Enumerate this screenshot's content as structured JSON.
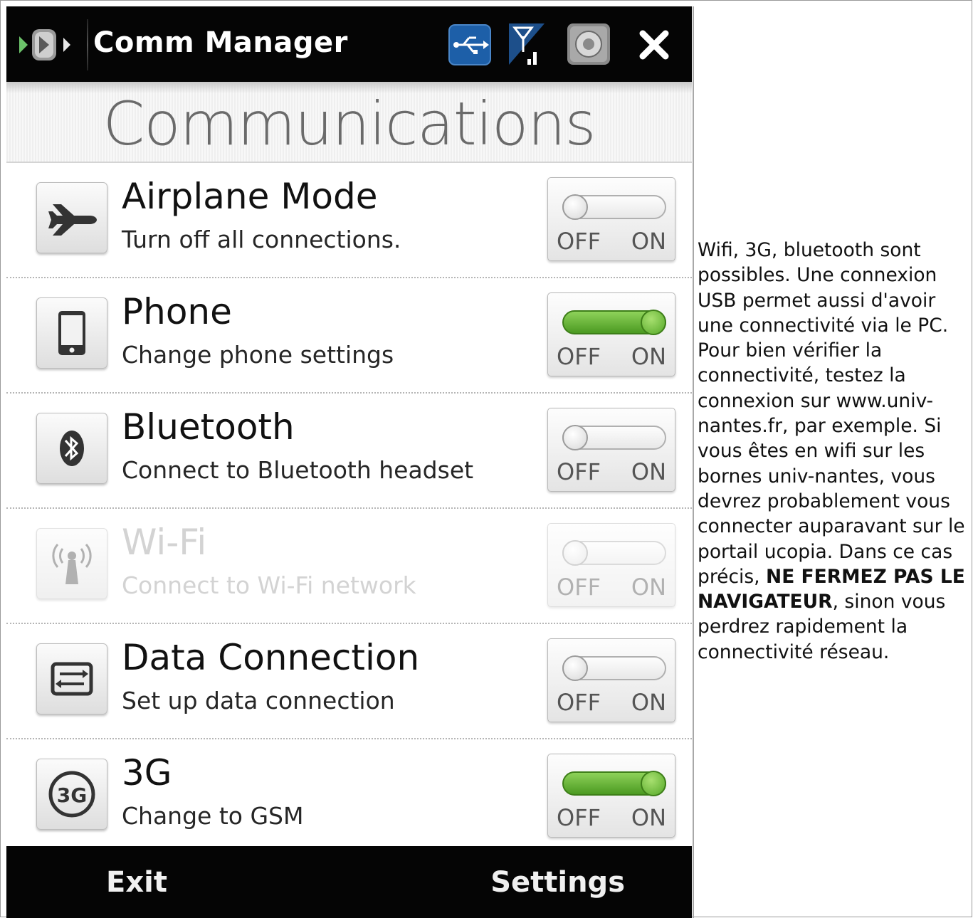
{
  "titlebar": {
    "title": "Comm Manager"
  },
  "header": {
    "title": "Communications"
  },
  "rows": [
    {
      "title": "Airplane Mode",
      "subtitle": "Turn off all connections.",
      "icon": "airplane-icon",
      "state": "off",
      "enabled": true,
      "off_label": "OFF",
      "on_label": "ON"
    },
    {
      "title": "Phone",
      "subtitle": "Change phone settings",
      "icon": "phone-icon",
      "state": "on",
      "enabled": true,
      "off_label": "OFF",
      "on_label": "ON"
    },
    {
      "title": "Bluetooth",
      "subtitle": "Connect to Bluetooth headset",
      "icon": "bluetooth-icon",
      "state": "off",
      "enabled": true,
      "off_label": "OFF",
      "on_label": "ON"
    },
    {
      "title": "Wi-Fi",
      "subtitle": "Connect to Wi-Fi network",
      "icon": "wifi-antenna-icon",
      "state": "off",
      "enabled": false,
      "off_label": "OFF",
      "on_label": "ON"
    },
    {
      "title": "Data Connection",
      "subtitle": "Set up data connection",
      "icon": "data-connection-icon",
      "state": "off",
      "enabled": true,
      "off_label": "OFF",
      "on_label": "ON"
    },
    {
      "title": "3G",
      "subtitle": "Change to GSM",
      "icon": "3g-icon",
      "icon_text": "3G",
      "state": "on",
      "enabled": true,
      "off_label": "OFF",
      "on_label": "ON"
    }
  ],
  "footer": {
    "left": "Exit",
    "right": "Settings"
  },
  "note": {
    "text_before": "Wifi, 3G, bluetooth sont possibles. Une connexion USB permet aussi d'avoir une connectivité via le PC. Pour bien vérifier la connectivité, testez la connexion sur www.univ-nantes.fr, par exemple. Si vous êtes en wifi sur les bornes univ-nantes, vous devrez probablement vous connecter auparavant sur le portail ucopia. Dans ce cas précis, ",
    "bold": "NE FERMEZ PAS LE NAVIGATEUR",
    "text_after": ", sinon vous perdrez rapidement la connectivité réseau."
  },
  "colors": {
    "toggle_on": "#5aa82a",
    "titlebar": "#050505",
    "usb_icon_bg": "#1d5fa8"
  }
}
